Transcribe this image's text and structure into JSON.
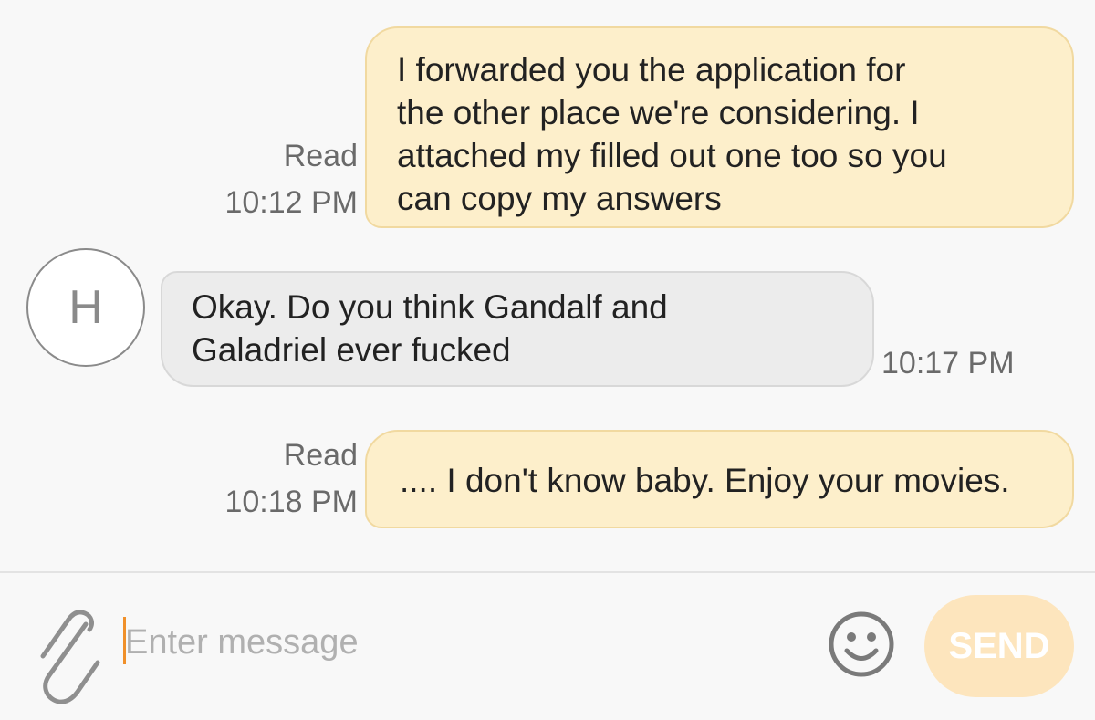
{
  "messages": [
    {
      "direction": "sent",
      "text": "I forwarded you the application for\nthe other place we're considering. I\nattached my filled out one too so you\ncan copy my answers",
      "status": "Read",
      "time": "10:12 PM"
    },
    {
      "direction": "received",
      "avatar_letter": "H",
      "text": "Okay. Do you think Gandalf and\nGaladriel ever fucked",
      "time": "10:17 PM"
    },
    {
      "direction": "sent",
      "text": ".... I don't know baby. Enjoy your movies.",
      "status": "Read",
      "time": "10:18 PM"
    }
  ],
  "composer": {
    "placeholder": "Enter message",
    "value": "",
    "send_label": "SEND",
    "attach_icon": "paperclip-icon",
    "emoji_icon": "smiley-icon"
  },
  "colors": {
    "sent_bubble": "#fdefcb",
    "received_bubble": "#ececec",
    "send_button": "#fde5bd",
    "cursor": "#f0902a"
  }
}
